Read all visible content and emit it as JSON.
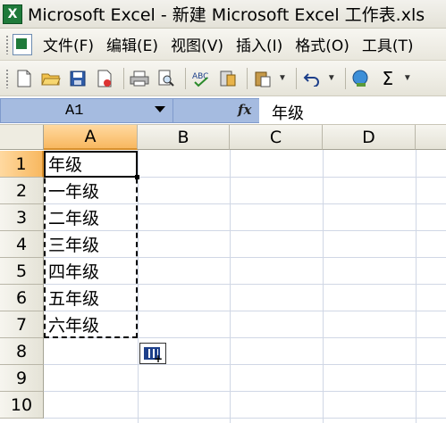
{
  "window": {
    "title": "Microsoft Excel - 新建 Microsoft Excel 工作表.xls",
    "app_icon": "excel-icon"
  },
  "menu": {
    "items": [
      {
        "label": "文件(F)"
      },
      {
        "label": "编辑(E)"
      },
      {
        "label": "视图(V)"
      },
      {
        "label": "插入(I)"
      },
      {
        "label": "格式(O)"
      },
      {
        "label": "工具(T)"
      }
    ]
  },
  "toolbar": {
    "icons": [
      "new-icon",
      "open-icon",
      "save-icon",
      "permission-icon",
      "print-icon",
      "print-preview-icon",
      "spelling-icon",
      "research-icon",
      "paste-icon",
      "undo-icon",
      "hyperlink-icon",
      "autosum-icon"
    ]
  },
  "formula_bar": {
    "name_box": "A1",
    "fx_label": "fx",
    "value": "年级"
  },
  "grid": {
    "columns": [
      "A",
      "B",
      "C",
      "D"
    ],
    "rows": [
      "1",
      "2",
      "3",
      "4",
      "5",
      "6",
      "7",
      "8",
      "9",
      "10"
    ],
    "selected_column": "A",
    "selected_row": "1",
    "cells_A": [
      "年级",
      "一年级",
      "二年级",
      "三年级",
      "四年级",
      "五年级",
      "六年级"
    ]
  },
  "colors": {
    "selected_header": "#f8b860",
    "name_box_bg": "#a5bbe0",
    "grid_line": "#d0d7e5"
  }
}
